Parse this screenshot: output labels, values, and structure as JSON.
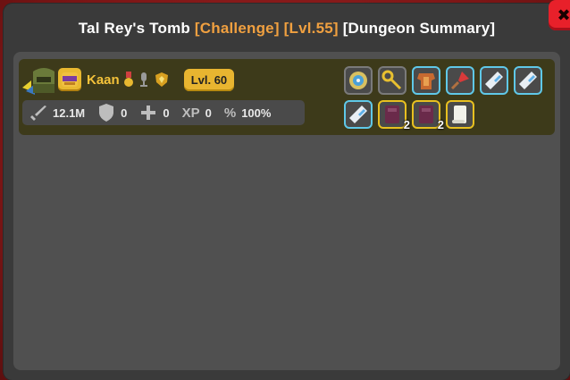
{
  "window": {
    "title_prefix": "Tal Rey's Tomb",
    "title_mode": "[Challenge]",
    "title_level": "[Lvl.55]",
    "title_suffix": "[Dungeon Summary]",
    "close_glyph": "✖"
  },
  "colors": {
    "background": "#8e1c1c",
    "window": "#3a3a3a",
    "panel": "#505050",
    "player_row": "#3d3a1a",
    "accent_orange": "#f0a040",
    "name_gold": "#f4c23a",
    "close_red": "#e8202a",
    "rarity_blue": "#5fc8e8",
    "rarity_gold": "#e8c020"
  },
  "player": {
    "name": "Kaan",
    "level": "Lvl. 60",
    "badges": [
      "medal-icon",
      "microphone-icon",
      "crest-icon"
    ],
    "stats": {
      "damage": "12.1M",
      "defense": "0",
      "healing": "0",
      "xp_label": "XP",
      "xp": "0",
      "percent_label": "%",
      "percent": "100%"
    }
  },
  "loot": [
    {
      "icon": "compass-gear-icon",
      "rarity": "grey",
      "qty": ""
    },
    {
      "icon": "golden-key-staff-icon",
      "rarity": "grey",
      "qty": ""
    },
    {
      "icon": "armor-chest-icon",
      "rarity": "blue",
      "qty": ""
    },
    {
      "icon": "red-crystal-wand-icon",
      "rarity": "blue",
      "qty": ""
    },
    {
      "icon": "potion-vial-icon",
      "rarity": "blue",
      "qty": ""
    },
    {
      "icon": "potion-vial-icon",
      "rarity": "blue",
      "qty": ""
    },
    {
      "icon": "potion-vial-icon",
      "rarity": "blue",
      "qty": ""
    },
    {
      "icon": "purple-tome-icon",
      "rarity": "gold",
      "qty": "2"
    },
    {
      "icon": "purple-tome-icon",
      "rarity": "gold",
      "qty": "2"
    },
    {
      "icon": "scroll-icon",
      "rarity": "gold",
      "qty": ""
    }
  ]
}
